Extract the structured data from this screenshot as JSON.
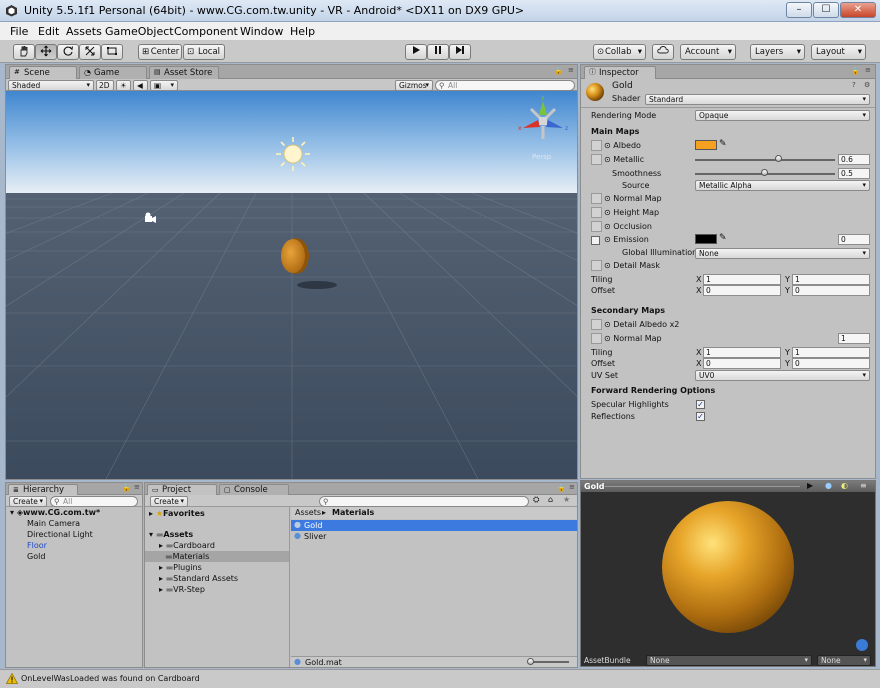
{
  "window": {
    "title": "Unity 5.5.1f1 Personal (64bit) - www.CG.com.tw.unity - VR - Android* <DX11 on DX9 GPU>"
  },
  "menu": [
    "File",
    "Edit",
    "Assets",
    "GameObject",
    "Component",
    "Window",
    "Help"
  ],
  "toolbar": {
    "center_label": "Center",
    "local_label": "Local",
    "collab_label": "Collab",
    "account_label": "Account",
    "layers_label": "Layers",
    "layout_label": "Layout"
  },
  "scene": {
    "tabs": [
      "Scene",
      "Game",
      "Asset Store"
    ],
    "shading_mode": "Shaded",
    "mode_2d": "2D",
    "gizmos_label": "Gizmos",
    "search_placeholder": "All",
    "persp_label": "Persp",
    "colors": {
      "sky_top": "#4a8fd0",
      "horizon": "#e8eef5",
      "ground": "#3e4c5e",
      "coin": "#c9861e"
    }
  },
  "hierarchy": {
    "tab": "Hierarchy",
    "create_label": "Create",
    "search_placeholder": "All",
    "scene_name": "www.CG.com.tw*",
    "items": [
      "Main Camera",
      "Directional Light",
      "Floor",
      "Gold"
    ]
  },
  "project": {
    "tabs": [
      "Project",
      "Console"
    ],
    "create_label": "Create",
    "favorites_label": "Favorites",
    "assets_label": "Assets",
    "folders": [
      "Cardboard",
      "Materials",
      "Plugins",
      "Standard Assets",
      "VR-Step"
    ],
    "breadcrumb": [
      "Assets",
      "Materials"
    ],
    "files": [
      "Gold",
      "Sliver"
    ],
    "footer_file": "Gold.mat"
  },
  "inspector": {
    "tab": "Inspector",
    "material_name": "Gold",
    "shader_label": "Shader",
    "shader_value": "Standard",
    "rendering_mode_label": "Rendering Mode",
    "rendering_mode_value": "Opaque",
    "main_maps_label": "Main Maps",
    "albedo_label": "Albedo",
    "albedo_color": "#f5a020",
    "metallic_label": "Metallic",
    "metallic_value": "0.6",
    "metallic_fraction": 0.6,
    "smoothness_label": "Smoothness",
    "smoothness_value": "0.5",
    "smoothness_fraction": 0.5,
    "source_label": "Source",
    "source_value": "Metallic Alpha",
    "normal_map_label": "Normal Map",
    "height_map_label": "Height Map",
    "occlusion_label": "Occlusion",
    "emission_label": "Emission",
    "emission_color": "#000000",
    "emission_value": "0",
    "gi_label": "Global Illumination",
    "gi_value": "None",
    "detail_mask_label": "Detail Mask",
    "tiling_label": "Tiling",
    "offset_label": "Offset",
    "x_label": "X",
    "y_label": "Y",
    "tiling_x": "1",
    "tiling_y": "1",
    "offset_x": "0",
    "offset_y": "0",
    "secondary_maps_label": "Secondary Maps",
    "detail_albedo_label": "Detail Albedo x2",
    "normal_map2_label": "Normal Map",
    "normal_map2_value": "1",
    "tiling2_x": "1",
    "tiling2_y": "1",
    "offset2_x": "0",
    "offset2_y": "0",
    "uv_set_label": "UV Set",
    "uv_set_value": "UV0",
    "forward_label": "Forward Rendering Options",
    "specular_label": "Specular Highlights",
    "reflections_label": "Reflections"
  },
  "preview": {
    "title": "Gold",
    "assetbundle_label": "AssetBundle",
    "assetbundle_value": "None",
    "variant_value": "None",
    "sphere_color": "#d99a1c"
  },
  "status": {
    "message": "OnLevelWasLoaded was found on Cardboard"
  }
}
